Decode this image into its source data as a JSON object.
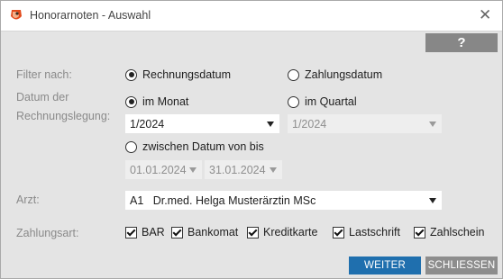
{
  "window": {
    "title": "Honorarnoten - Auswahl"
  },
  "help": {
    "label": "?"
  },
  "filter": {
    "label": "Filter nach:",
    "option_invoice_date": "Rechnungsdatum",
    "option_payment_date": "Zahlungsdatum",
    "selected": "Rechnungsdatum"
  },
  "date": {
    "label_line1": "Datum der",
    "label_line2": "Rechnungslegung:",
    "option_month": "im Monat",
    "option_quarter": "im Quartal",
    "option_range": "zwischen Datum von bis",
    "selected": "im Monat",
    "month_value": "1/2024",
    "quarter_value": "1/2024",
    "range_from": "01.01.2024",
    "range_to": "31.01.2024"
  },
  "doctor": {
    "label": "Arzt:",
    "value": "A1   Dr.med. Helga Musterärztin MSc"
  },
  "payment": {
    "label": "Zahlungsart:",
    "options": [
      {
        "label": "BAR",
        "checked": true
      },
      {
        "label": "Bankomat",
        "checked": true
      },
      {
        "label": "Kreditkarte",
        "checked": true
      },
      {
        "label": "Lastschrift",
        "checked": true
      },
      {
        "label": "Zahlschein",
        "checked": true
      }
    ]
  },
  "buttons": {
    "next": "WEITER",
    "close": "SCHLIESSEN"
  },
  "colors": {
    "primary": "#1f6fae",
    "secondary": "#8d8d8d",
    "panel": "#e4e4e4"
  }
}
